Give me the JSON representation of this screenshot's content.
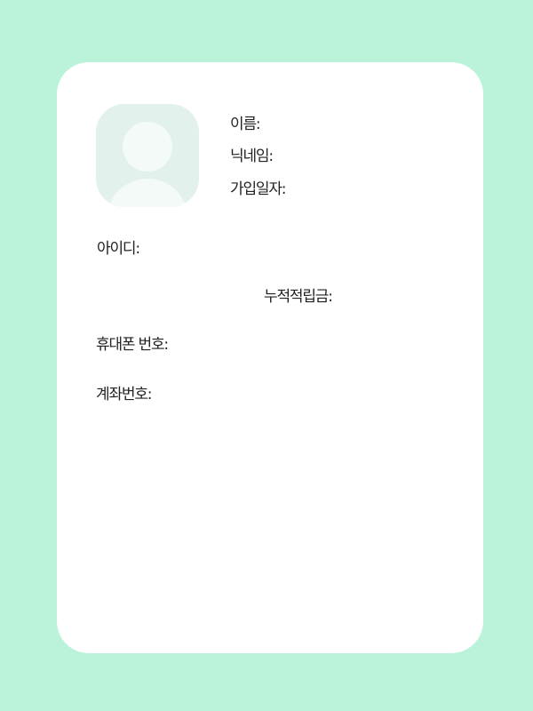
{
  "profile": {
    "name_label": "이름:",
    "nickname_label": "닉네임:",
    "join_date_label": "가입일자:",
    "user_id_label": "아이디:",
    "points_label": "누적적립금:",
    "phone_label": "휴대폰 번호:",
    "account_label": "계좌번호:"
  },
  "colors": {
    "background": "#BAF3D9",
    "card": "#FFFFFF",
    "avatar_bg": "#E2F1EC",
    "avatar_fg": "#F4FAF7"
  },
  "icons": {
    "avatar": "user-placeholder-icon"
  }
}
